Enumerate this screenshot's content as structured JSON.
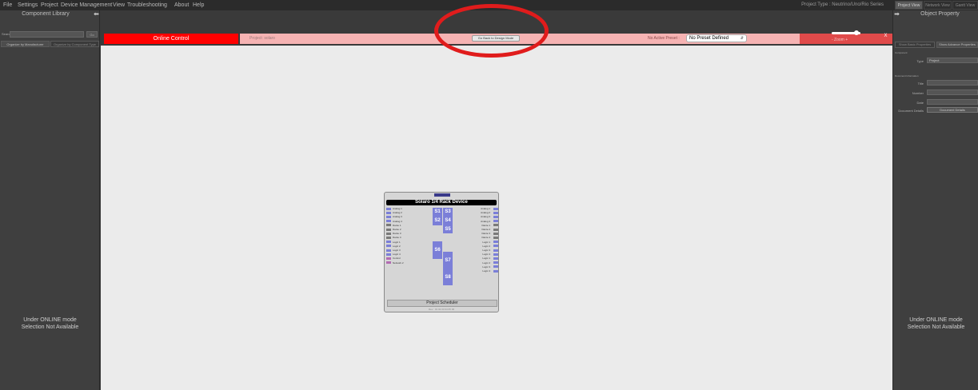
{
  "menubar": {
    "items": [
      "File",
      "Settings",
      "Project",
      "Device Management",
      "View",
      "Troubleshooting",
      "About",
      "Help"
    ],
    "project_type": "Project Type : Neutrino/Uno/Rio Series",
    "view_tabs": [
      "Project View",
      "Network View",
      "Gantt View"
    ]
  },
  "left_panel": {
    "title": "Component Library",
    "collapse_icon": "arrow-left-icon",
    "search_label": "Search",
    "search_value": "",
    "search_button": "Go",
    "tabs": [
      "Organize by Manufacturer",
      "Organize by Component Type"
    ],
    "online_message_line1": "Under ONLINE mode",
    "online_message_line2": "Selection Not Available"
  },
  "toolbar": {
    "mode_label": "Online Control",
    "project_label": "Project: solaro",
    "back_button": "Go Back to Design Mode",
    "preset_label": "No Active Preset :",
    "preset_value": "No Preset Defined",
    "zoom_label": "-  Zoom  +",
    "zoom_level": 0.85,
    "close_label": "X"
  },
  "device": {
    "title": "Solaro 1/4 Rack Device",
    "left_io": [
      "Analog 1",
      "Analog 2",
      "Analog 3",
      "Analog 4",
      "Dante 1",
      "Dante 2",
      "Dante 3",
      "Dante 4",
      "Logic 1",
      "Logic 2",
      "Logic 3",
      "Logic 4",
      "Control",
      "Network 2"
    ],
    "right_io": [
      "Analog 1",
      "Analog 2",
      "Analog 3",
      "Analog 4",
      "Dante 1",
      "Dante 2",
      "Dante 3",
      "Dante 4",
      "Logic 1",
      "Logic 2",
      "Logic 3",
      "Logic 4",
      "Logic 1",
      "Logic 2",
      "Logic 3",
      "Logic 4"
    ],
    "blocks": [
      "S1",
      "S2",
      "S3",
      "S4",
      "S5",
      "S6",
      "S7",
      "S8"
    ],
    "scheduler": "Project Scheduler",
    "footer": "Rev : 01 02 03 04 05 06"
  },
  "right_panel": {
    "title": "Object Property",
    "expand_icon": "arrow-right-icon",
    "buttons": [
      "Show Basic Properties",
      "Show Advance Properties"
    ],
    "section_component": "Component",
    "type_label": "Type",
    "type_value": "Project",
    "section_document": "Document Information",
    "fields": [
      "Title",
      "Number",
      "Date"
    ],
    "doc_details_label": "Document Details",
    "doc_details_button": "Document Details",
    "online_message_line1": "Under ONLINE mode",
    "online_message_line2": "Selection Not Available"
  },
  "colors": {
    "online_red": "#ff0000",
    "pink_bar": "#f6b3b3",
    "block_blue": "#7b7fd8",
    "annotation_red": "#e01c1c"
  }
}
